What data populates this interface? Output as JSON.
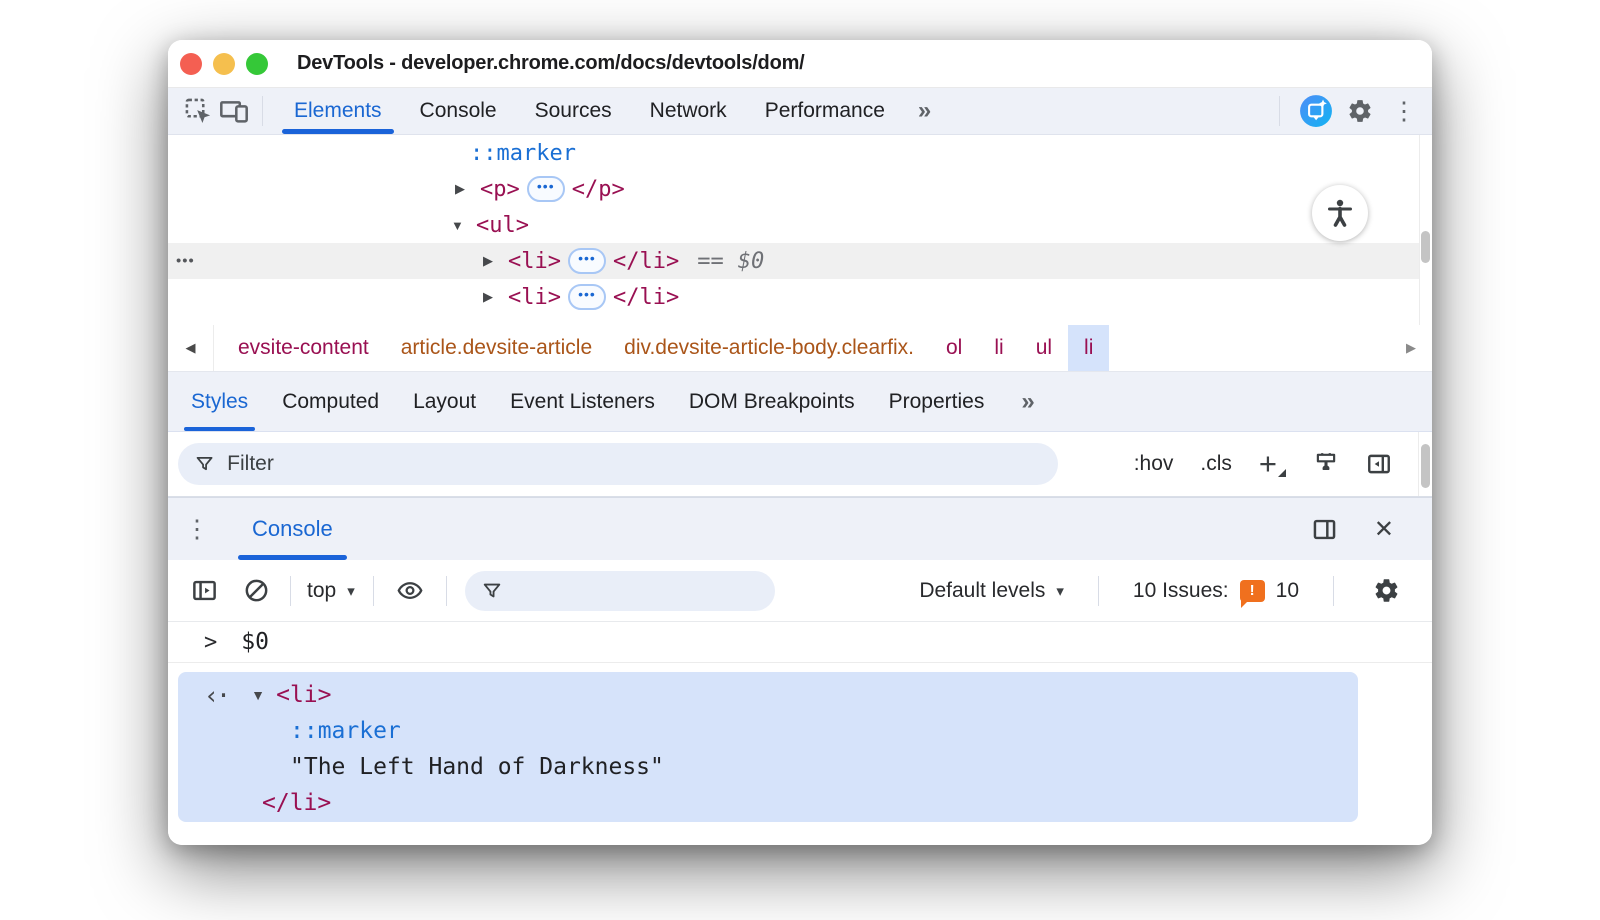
{
  "window": {
    "title": "DevTools - developer.chrome.com/docs/devtools/dom/"
  },
  "icons": {
    "kebab": "⋮",
    "close": "✕",
    "chevron_more": "»",
    "dropdown_caret": "▾",
    "back_arrow": "◀",
    "forward_arrow": "▶",
    "expander_closed": "▶",
    "expander_open": "▼",
    "gutter_dots": "•••",
    "ellipsis_pill": "•••",
    "returned": "‹·",
    "prompt": ">",
    "issues_badge_glyph": "!"
  },
  "main_tabs": {
    "items": [
      {
        "label": "Elements"
      },
      {
        "label": "Console"
      },
      {
        "label": "Sources"
      },
      {
        "label": "Network"
      },
      {
        "label": "Performance"
      }
    ]
  },
  "dom_tree": {
    "marker": "::marker",
    "p_open": "<p>",
    "p_close": "</p>",
    "ul_open": "<ul>",
    "li_open": "<li>",
    "li_close": "</li>",
    "eq": "==",
    "dollar": "$0"
  },
  "breadcrumb": {
    "items": [
      {
        "label": "evsite-content"
      },
      {
        "label": "article.devsite-article"
      },
      {
        "label": "div.devsite-article-body.clearfix."
      },
      {
        "label": "ol"
      },
      {
        "label": "li"
      },
      {
        "label": "ul"
      },
      {
        "label": "li"
      }
    ]
  },
  "styles_panel": {
    "tabs": [
      {
        "label": "Styles"
      },
      {
        "label": "Computed"
      },
      {
        "label": "Layout"
      },
      {
        "label": "Event Listeners"
      },
      {
        "label": "DOM Breakpoints"
      },
      {
        "label": "Properties"
      }
    ],
    "filter_placeholder": "Filter",
    "hov": ":hov",
    "cls": ".cls"
  },
  "console_drawer": {
    "tab": "Console",
    "context": "top",
    "levels": "Default levels",
    "issues_label": "10 Issues:",
    "issues_count": "10",
    "command": "$0",
    "result": {
      "li_open": "<li>",
      "marker": "::marker",
      "string": "\"The Left Hand of Darkness\"",
      "li_close": "</li>"
    }
  },
  "colors": {
    "accent_blue": "#1a67d2",
    "tag_color": "#991052",
    "class_color": "#aa5519",
    "pseudo_blue": "#1a6fd4",
    "issues_orange": "#f0701e"
  }
}
